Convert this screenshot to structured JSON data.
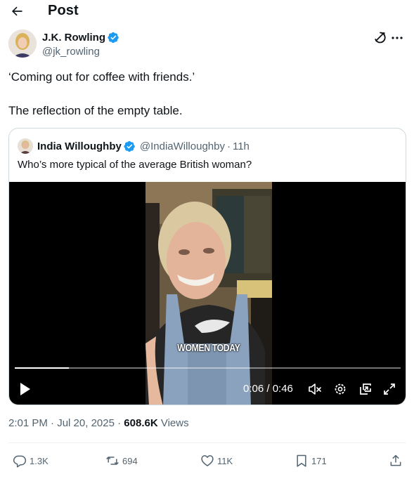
{
  "header": {
    "title": "Post",
    "back_icon": "arrow-left-icon"
  },
  "author": {
    "name": "J.K. Rowling",
    "handle": "@jk_rowling",
    "verified_color": "#1d9bf0"
  },
  "post": {
    "lines": [
      "‘Coming out for coffee with friends.’",
      "The reflection of the empty table."
    ]
  },
  "quote": {
    "name": "India Willoughby",
    "handle": "@IndiaWilloughby",
    "separator": "·",
    "time": "11h",
    "text": "Who’s more typical of the average British woman?",
    "video": {
      "caption": "WOMEN TODAY",
      "time_display": "0:06 / 0:46",
      "progress": 0.14
    }
  },
  "meta": {
    "time": "2:01 PM",
    "date": "Jul 20, 2025",
    "separator": "·",
    "views_count": "608.6K",
    "views_label": "Views"
  },
  "actions": {
    "replies": "1.3K",
    "reposts": "694",
    "likes": "11K",
    "bookmarks": "171"
  },
  "colors": {
    "text": "#0f1419",
    "secondary": "#536471",
    "border": "#cfd9de",
    "accent": "#1d9bf0"
  }
}
